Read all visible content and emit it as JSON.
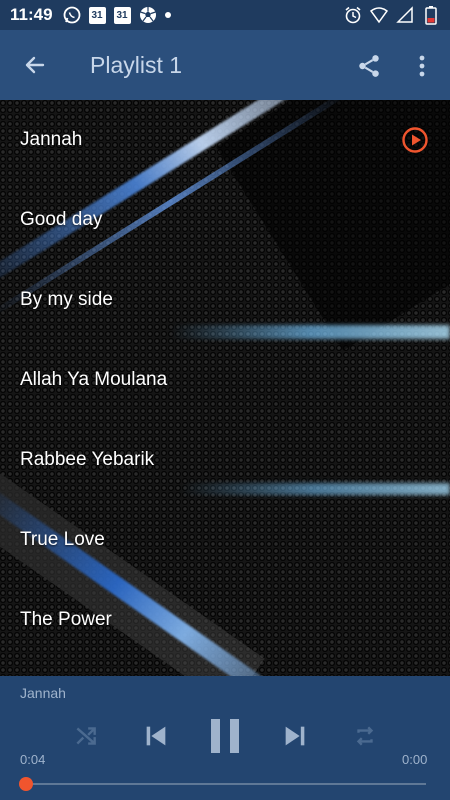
{
  "status_bar": {
    "time": "11:49",
    "left_icons": [
      "whatsapp-icon",
      "calendar-icon",
      "calendar-icon",
      "soccer-ball-icon",
      "dot-icon"
    ],
    "calendar_day": "31",
    "right_icons": [
      "alarm-icon",
      "wifi-icon",
      "signal-icon",
      "battery-icon"
    ]
  },
  "app_bar": {
    "title": "Playlist 1",
    "back_icon": "arrow-left-icon",
    "share_icon": "share-icon",
    "more_icon": "more-vertical-icon"
  },
  "playlist": {
    "songs": [
      {
        "title": "Jannah",
        "playing": true
      },
      {
        "title": "Good day",
        "playing": false
      },
      {
        "title": "By my side",
        "playing": false
      },
      {
        "title": "Allah Ya Moulana",
        "playing": false
      },
      {
        "title": "Rabbee Yebarik",
        "playing": false
      },
      {
        "title": "True Love",
        "playing": false
      },
      {
        "title": "The Power",
        "playing": false
      }
    ]
  },
  "player": {
    "now_playing": "Jannah",
    "elapsed": "0:04",
    "total": "0:00",
    "progress_fraction": 0.0,
    "controls": [
      "shuffle-icon",
      "skip-previous-icon",
      "pause-icon",
      "skip-next-icon",
      "repeat-icon"
    ]
  },
  "colors": {
    "status_bar": "#1f3b5f",
    "app_bar": "#2b4f7c",
    "player_bg": "#234570",
    "accent": "#f0552e",
    "muted_text": "#9fb3cc"
  }
}
